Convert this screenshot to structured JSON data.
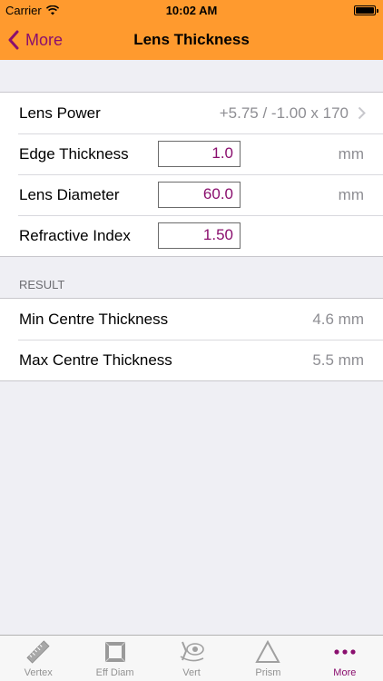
{
  "status_bar": {
    "carrier": "Carrier",
    "time": "10:02 AM"
  },
  "nav": {
    "back_label": "More",
    "title": "Lens Thickness"
  },
  "inputs": {
    "lens_power": {
      "label": "Lens Power",
      "value": "+5.75 / -1.00 x 170"
    },
    "edge_thickness": {
      "label": "Edge Thickness",
      "value": "1.0",
      "unit": "mm"
    },
    "lens_diameter": {
      "label": "Lens Diameter",
      "value": "60.0",
      "unit": "mm"
    },
    "refractive_index": {
      "label": "Refractive Index",
      "value": "1.50"
    }
  },
  "result": {
    "header": "RESULT",
    "min": {
      "label": "Min Centre Thickness",
      "value": "4.6 mm"
    },
    "max": {
      "label": "Max Centre Thickness",
      "value": "5.5 mm"
    }
  },
  "tabs": [
    {
      "label": "Vertex",
      "icon": "ruler-icon"
    },
    {
      "label": "Eff Diam",
      "icon": "frame-icon"
    },
    {
      "label": "Vert",
      "icon": "eye-lens-icon"
    },
    {
      "label": "Prism",
      "icon": "triangle-icon"
    },
    {
      "label": "More",
      "icon": "more-dots-icon",
      "active": true
    }
  ],
  "colors": {
    "accent": "#8a0f6e",
    "navbar": "#ff9a2e",
    "background": "#efeff4"
  }
}
